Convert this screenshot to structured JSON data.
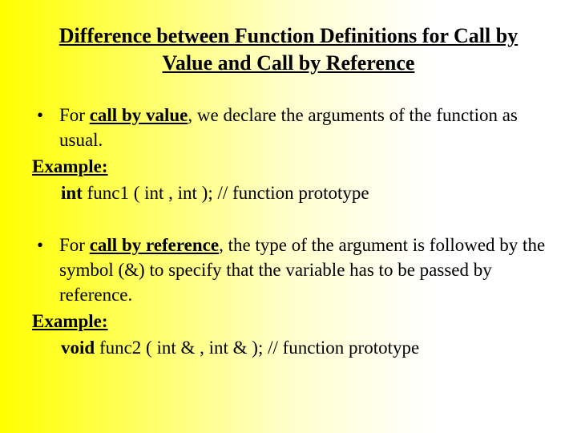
{
  "title": "Difference between Function Definitions for Call by Value and Call by Reference",
  "sections": [
    {
      "bullet_pre": "For ",
      "bullet_key": "call by value",
      "bullet_post": ", we declare the arguments of the function as usual.",
      "example_label": "Example:",
      "code_ret": "int",
      "code_rest": " func1 ( int , int );   // function prototype"
    },
    {
      "bullet_pre": "For ",
      "bullet_key": "call by reference",
      "bullet_post": ", the type of the argument is followed by the symbol (&) to specify that the variable has to be passed by reference.",
      "example_label": "Example:",
      "code_ret": "void",
      "code_rest": " func2 ( int & , int & );   // function prototype"
    }
  ],
  "bullet_char": "•"
}
